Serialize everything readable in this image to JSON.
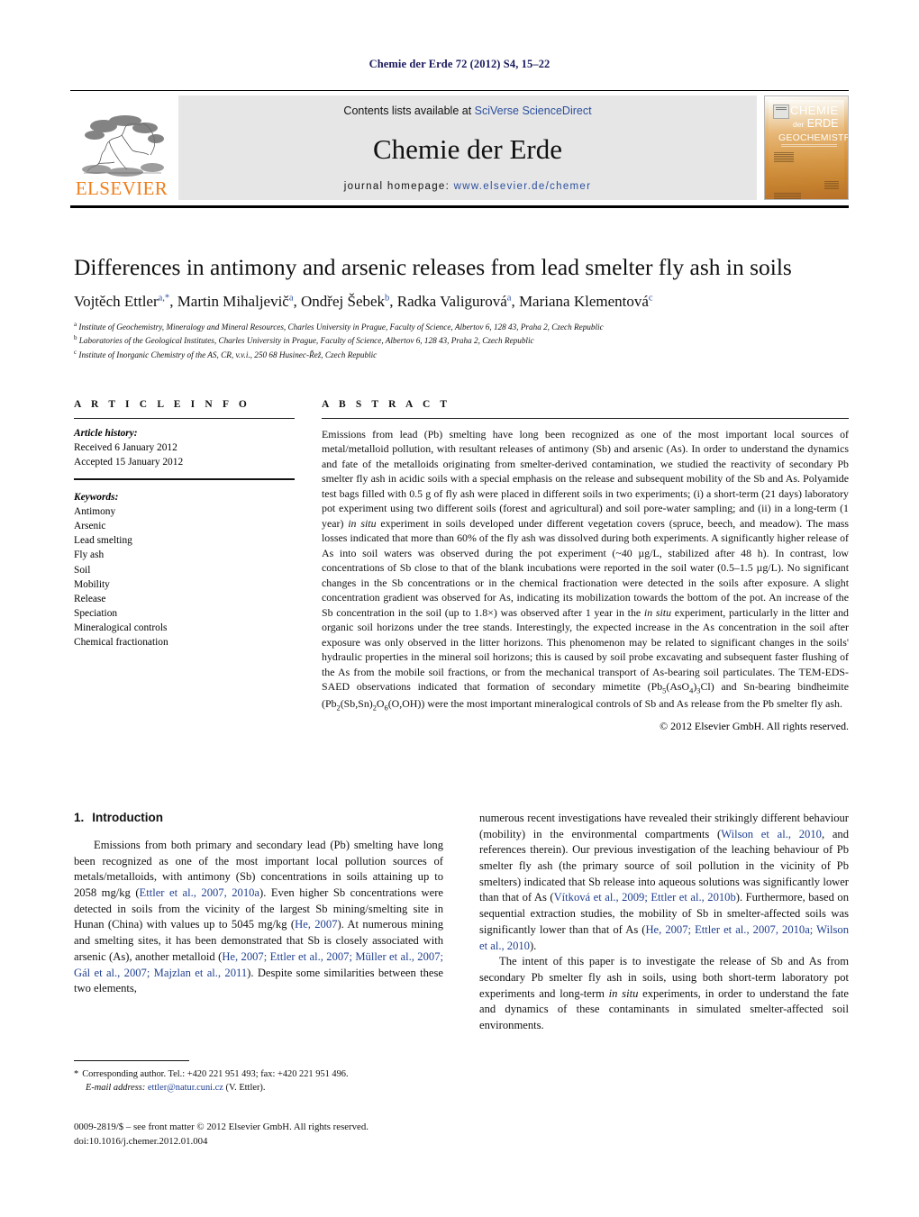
{
  "running_head": "Chemie der Erde 72 (2012) S4, 15–22",
  "masthead": {
    "contents_prefix": "Contents lists available at ",
    "sciencedirect": "SciVerse ScienceDirect",
    "journal_name": "Chemie der Erde",
    "homepage_prefix": "journal homepage: ",
    "homepage_url": "www.elsevier.de/chemer",
    "publisher": "ELSEVIER",
    "cover": {
      "line1": "CHEMIE",
      "der": "der",
      "erde": "ERDE",
      "line3": "GEOCHEMISTRY"
    },
    "accent_orange": "#F07F1A",
    "link_blue": "#2b4f9e"
  },
  "article": {
    "title": "Differences in antimony and arsenic releases from lead smelter fly ash in soils",
    "authors": [
      {
        "name": "Vojtěch Ettler",
        "marks": "a,*"
      },
      {
        "name": "Martin Mihaljevič",
        "marks": "a"
      },
      {
        "name": "Ondřej Šebek",
        "marks": "b"
      },
      {
        "name": "Radka Valigurová",
        "marks": "a"
      },
      {
        "name": "Mariana Klementová",
        "marks": "c"
      }
    ],
    "affiliations": [
      {
        "mark": "a",
        "text": "Institute of Geochemistry, Mineralogy and Mineral Resources, Charles University in Prague, Faculty of Science, Albertov 6, 128 43, Praha 2, Czech Republic"
      },
      {
        "mark": "b",
        "text": "Laboratories of the Geological Institutes, Charles University in Prague, Faculty of Science, Albertov 6, 128 43, Praha 2, Czech Republic"
      },
      {
        "mark": "c",
        "text": "Institute of Inorganic Chemistry of the AS, CR, v.v.i., 250 68 Husinec-Řež, Czech Republic"
      }
    ]
  },
  "article_info": {
    "heading": "A R T I C L E    I N F O",
    "history_label": "Article history:",
    "received": "Received 6 January 2012",
    "accepted": "Accepted 15 January 2012",
    "keywords_label": "Keywords:",
    "keywords": [
      "Antimony",
      "Arsenic",
      "Lead smelting",
      "Fly ash",
      "Soil",
      "Mobility",
      "Release",
      "Speciation",
      "Mineralogical controls",
      "Chemical fractionation"
    ]
  },
  "abstract": {
    "heading": "A B S T R A C T",
    "part1": "Emissions from lead (Pb) smelting have long been recognized as one of the most important local sources of metal/metalloid pollution, with resultant releases of antimony (Sb) and arsenic (As). In order to understand the dynamics and fate of the metalloids originating from smelter-derived contamination, we studied the reactivity of secondary Pb smelter fly ash in acidic soils with a special emphasis on the release and subsequent mobility of the Sb and As. Polyamide test bags filled with 0.5 g of fly ash were placed in different soils in two experiments; (i) a short-term (21 days) laboratory pot experiment using two different soils (forest and agricultural) and soil pore-water sampling; and (ii) in a long-term (1 year) ",
    "italic1": "in situ",
    "part2": " experiment in soils developed under different vegetation covers (spruce, beech, and meadow). The mass losses indicated that more than 60% of the fly ash was dissolved during both experiments. A significantly higher release of As into soil waters was observed during the pot experiment (~40 µg/L, stabilized after 48 h). In contrast, low concentrations of Sb close to that of the blank incubations were reported in the soil water (0.5–1.5 µg/L). No significant changes in the Sb concentrations or in the chemical fractionation were detected in the soils after exposure. A slight concentration gradient was observed for As, indicating its mobilization towards the bottom of the pot. An increase of the Sb concentration in the soil (up to 1.8×) was observed after 1 year in the ",
    "italic2": "in situ",
    "part3": " experiment, particularly in the litter and organic soil horizons under the tree stands. Interestingly, the expected increase in the As concentration in the soil after exposure was only observed in the litter horizons. This phenomenon may be related to significant changes in the soils' hydraulic properties in the mineral soil horizons; this is caused by soil probe excavating and subsequent faster flushing of the As from the mobile soil fractions, or from the mechanical transport of As-bearing soil particulates. The TEM-EDS-SAED observations indicated that formation of secondary mimetite (Pb",
    "formula1_sub1": "5",
    "formula1_mid": "(AsO",
    "formula1_sub2": "4",
    "formula1_sub3": "3",
    "formula1_end": ")",
    "formula1_cl": "Cl) and Sn-bearing bindheimite (Pb",
    "formula2_sub1": "2",
    "formula2_mid": "(Sb,Sn)",
    "formula2_sub2": "2",
    "formula2_o": "O",
    "formula2_sub3": "6",
    "formula2_end": "(O,OH)) were the most important mineralogical controls of Sb and As release from the Pb smelter fly ash.",
    "copyright": "© 2012 Elsevier GmbH. All rights reserved."
  },
  "sections": {
    "intro_number": "1.",
    "intro_title": "Introduction",
    "left_p1_a": "Emissions from both primary and secondary lead (Pb) smelting have long been recognized as one of the most important local pollution sources of metals/metalloids, with antimony (Sb) concentrations in soils attaining up to 2058 mg/kg (",
    "ref1": "Ettler et al., 2007, 2010a",
    "left_p1_b": "). Even higher Sb concentrations were detected in soils from the vicinity of the largest Sb mining/smelting site in Hunan (China) with values up to 5045 mg/kg (",
    "ref2": "He, 2007",
    "left_p1_c": "). At numerous mining and smelting sites, it has been demonstrated that Sb is closely associated with arsenic (As), another metalloid (",
    "ref3": "He, 2007; Ettler et al., 2007; Müller et al., 2007; Gál et al., 2007; Majzlan et al., 2011",
    "left_p1_d": "). Despite some similarities between these two elements,",
    "right_p1_a": "numerous recent investigations have revealed their strikingly different behaviour (mobility) in the environmental compartments (",
    "ref4": "Wilson et al., 2010",
    "right_p1_b": ", and references therein). Our previous investigation of the leaching behaviour of Pb smelter fly ash (the primary source of soil pollution in the vicinity of Pb smelters) indicated that Sb release into aqueous solutions was significantly lower than that of As (",
    "ref5": "Vítková et al., 2009; Ettler et al., 2010b",
    "right_p1_c": "). Furthermore, based on sequential extraction studies, the mobility of Sb in smelter-affected soils was significantly lower than that of As (",
    "ref6": "He, 2007; Ettler et al., 2007, 2010a; Wilson et al., 2010",
    "right_p1_d": ").",
    "right_p2_a": "The intent of this paper is to investigate the release of Sb and As from secondary Pb smelter fly ash in soils, using both short-term laboratory pot experiments and long-term ",
    "right_p2_italic": "in situ",
    "right_p2_b": " experiments, in order to understand the fate and dynamics of these contaminants in simulated smelter-affected soil environments."
  },
  "footnote": {
    "star": "*",
    "corresponding": "Corresponding author. Tel.: +420 221 951 493; fax: +420 221 951 496.",
    "email_label": "E-mail address:",
    "email": "ettler@natur.cuni.cz",
    "email_suffix": "(V. Ettler)."
  },
  "imprint": {
    "line1": "0009-2819/$ – see front matter © 2012 Elsevier GmbH. All rights reserved.",
    "doi_label": "doi:",
    "doi": "10.1016/j.chemer.2012.01.004"
  }
}
